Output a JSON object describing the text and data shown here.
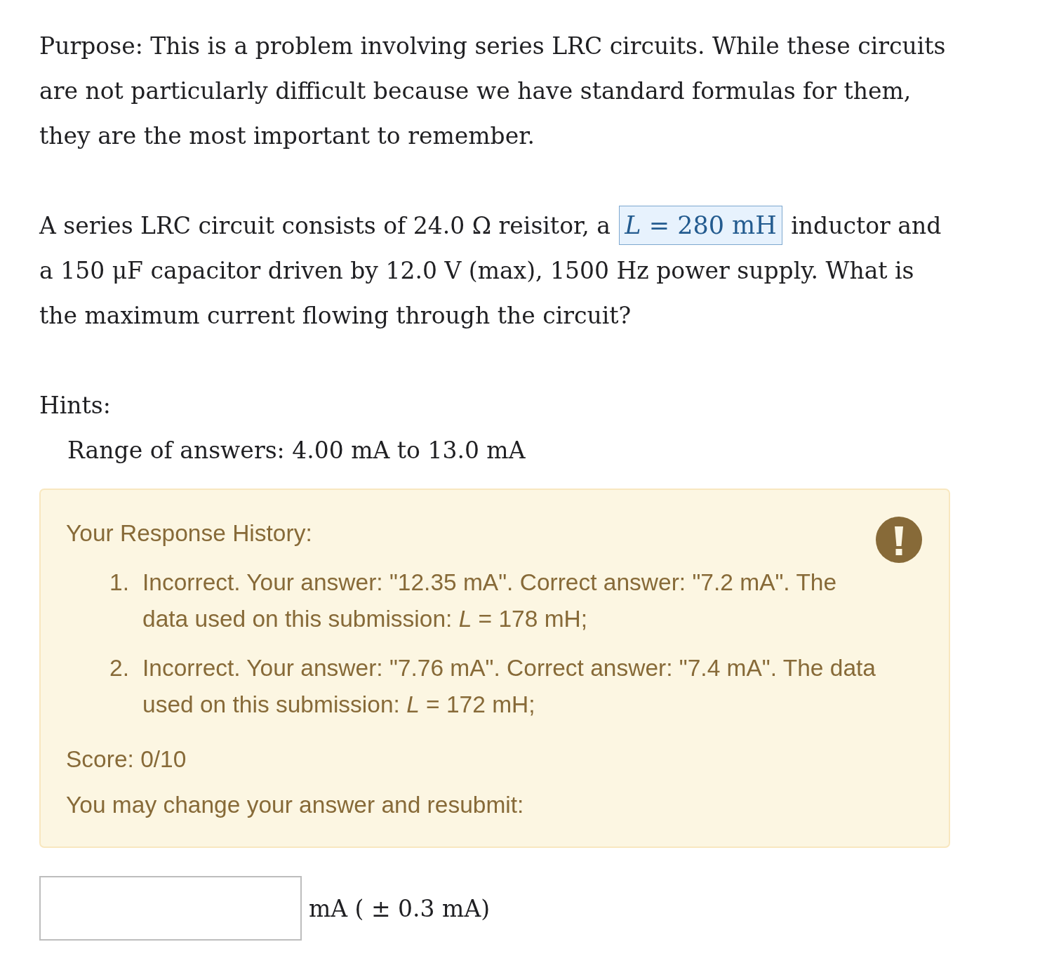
{
  "purpose": "Purpose: This is a problem involving series LRC circuits. While these circuits are not particularly difficult because we have standard formulas for them, they are the most important to remember.",
  "question": {
    "before": "A series LRC circuit consists of 24.0 Ω reisitor, a",
    "value": "*L* = 280 mH",
    "after": "inductor and a 150 μF capacitor driven by 12.0 V (max), 1500 Hz power supply. What is the maximum current flowing through the circuit?"
  },
  "hints": {
    "label": "Hints:",
    "items": [
      "Range of answers: 4.00 mA to 13.0 mA"
    ]
  },
  "response_history": {
    "correct": false,
    "title": "Your Response History:",
    "entries": [
      {
        "number": "1.",
        "text": "Incorrect. Your answer: \"12.35 mA\". Correct answer: \"7.2 mA\". The data used on this submission: *L* = 178 mH;"
      },
      {
        "number": "2.",
        "text": "Incorrect. Your answer: \"7.76 mA\". Correct answer: \"7.4 mA\". The data used on this submission: *L* = 172 mH;"
      }
    ],
    "score": "Score: 0/10",
    "message": "You may change your answer and resubmit:"
  },
  "answer": {
    "unit": "mA ( ± 0.3 mA)"
  }
}
